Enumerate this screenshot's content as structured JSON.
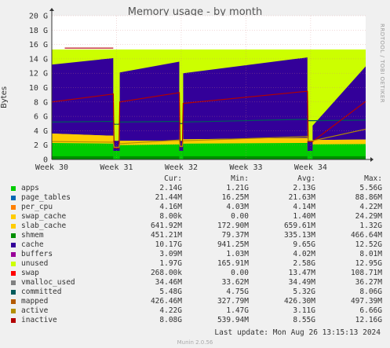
{
  "title": "Memory usage - by month",
  "side_label": "RRDTOOL / TOBI OETIKER",
  "version": "Munin 2.0.56",
  "last_update": "Last update: Mon Aug 26 13:15:13 2024",
  "legend_headers": [
    "Cur:",
    "Min:",
    "Avg:",
    "Max:"
  ],
  "legend": [
    {
      "name": "apps",
      "color": "#00cc00",
      "cur": "2.14G",
      "min": "1.21G",
      "avg": "2.13G",
      "max": "5.56G"
    },
    {
      "name": "page_tables",
      "color": "#0066b3",
      "cur": "21.44M",
      "min": "16.25M",
      "avg": "21.63M",
      "max": "88.86M"
    },
    {
      "name": "per_cpu",
      "color": "#ff8000",
      "cur": "4.16M",
      "min": "4.03M",
      "avg": "4.14M",
      "max": "4.22M"
    },
    {
      "name": "swap_cache",
      "color": "#ffcc00",
      "cur": "8.00k",
      "min": "0.00",
      "avg": "1.40M",
      "max": "24.29M"
    },
    {
      "name": "slab_cache",
      "color": "#ffcc00",
      "cur": "641.92M",
      "min": "172.90M",
      "avg": "659.61M",
      "max": "1.32G"
    },
    {
      "name": "shmem",
      "color": "#008f00",
      "cur": "451.21M",
      "min": "79.37M",
      "avg": "335.13M",
      "max": "466.64M"
    },
    {
      "name": "cache",
      "color": "#330099",
      "cur": "10.17G",
      "min": "941.25M",
      "avg": "9.65G",
      "max": "12.52G"
    },
    {
      "name": "buffers",
      "color": "#990099",
      "cur": "3.09M",
      "min": "1.03M",
      "avg": "4.02M",
      "max": "8.01M"
    },
    {
      "name": "unused",
      "color": "#ccff00",
      "cur": "1.97G",
      "min": "165.91M",
      "avg": "2.58G",
      "max": "12.95G"
    },
    {
      "name": "swap",
      "color": "#ff0000",
      "cur": "268.00k",
      "min": "0.00",
      "avg": "13.47M",
      "max": "108.71M"
    },
    {
      "name": "vmalloc_used",
      "color": "#808080",
      "cur": "34.46M",
      "min": "33.62M",
      "avg": "34.49M",
      "max": "36.27M"
    },
    {
      "name": "committed",
      "color": "#005a5a",
      "cur": "5.48G",
      "min": "4.75G",
      "avg": "5.32G",
      "max": "8.06G"
    },
    {
      "name": "mapped",
      "color": "#b35a00",
      "cur": "426.46M",
      "min": "327.79M",
      "avg": "426.30M",
      "max": "497.39M"
    },
    {
      "name": "active",
      "color": "#b38f00",
      "cur": "4.22G",
      "min": "1.47G",
      "avg": "3.11G",
      "max": "6.66G"
    },
    {
      "name": "inactive",
      "color": "#b30000",
      "cur": "8.08G",
      "min": "539.94M",
      "avg": "8.55G",
      "max": "12.16G"
    }
  ],
  "chart_data": {
    "type": "area",
    "title": "Memory usage - by month",
    "ylabel": "Bytes",
    "ylim": [
      0,
      20
    ],
    "y_unit": "G",
    "y_ticks": [
      "0",
      "2 G",
      "4 G",
      "6 G",
      "8 G",
      "10 G",
      "12 G",
      "14 G",
      "16 G",
      "18 G",
      "20 G"
    ],
    "x_ticks": [
      "Week 30",
      "Week 31",
      "Week 32",
      "Week 33",
      "Week 34"
    ],
    "total_memory_gb": 15.3,
    "segments": [
      {
        "start": 0.0,
        "end": 0.95
      },
      {
        "start": 1.05,
        "end": 1.97
      },
      {
        "start": 2.03,
        "end": 3.95
      },
      {
        "start": 4.03,
        "end": 4.85
      }
    ],
    "series": [
      {
        "name": "apps",
        "color": "#00cc00",
        "values": [
          2.3,
          2.2,
          1.4,
          2.0,
          2.1,
          1.8,
          2.2,
          2.3,
          2.1,
          2.14
        ]
      },
      {
        "name": "slab_cache",
        "color": "#ffcc00",
        "values": [
          1.3,
          1.1,
          0.3,
          0.6,
          0.5,
          0.3,
          0.6,
          0.7,
          0.6,
          0.64
        ]
      },
      {
        "name": "cache",
        "color": "#330099",
        "values": [
          9.6,
          10.8,
          1.5,
          9.5,
          11.0,
          1.6,
          9.2,
          11.2,
          2.0,
          10.17
        ]
      },
      {
        "name": "committed",
        "color": "#005a5a",
        "values": [
          5.2,
          5.3,
          4.9,
          5.2,
          5.3,
          5.0,
          5.2,
          5.6,
          5.4,
          5.48
        ]
      },
      {
        "name": "inactive",
        "color": "#b30000",
        "values": [
          8.0,
          9.1,
          1.6,
          8.0,
          9.3,
          1.8,
          7.8,
          9.5,
          2.5,
          8.08
        ]
      },
      {
        "name": "active",
        "color": "#b38f00",
        "values": [
          2.5,
          2.4,
          1.7,
          2.2,
          2.7,
          1.8,
          2.6,
          3.2,
          2.6,
          4.22
        ]
      },
      {
        "name": "swap",
        "color": "#ff0000",
        "values": [
          15.5,
          15.5,
          0,
          0,
          0,
          0,
          0,
          0,
          0,
          0
        ]
      }
    ]
  }
}
